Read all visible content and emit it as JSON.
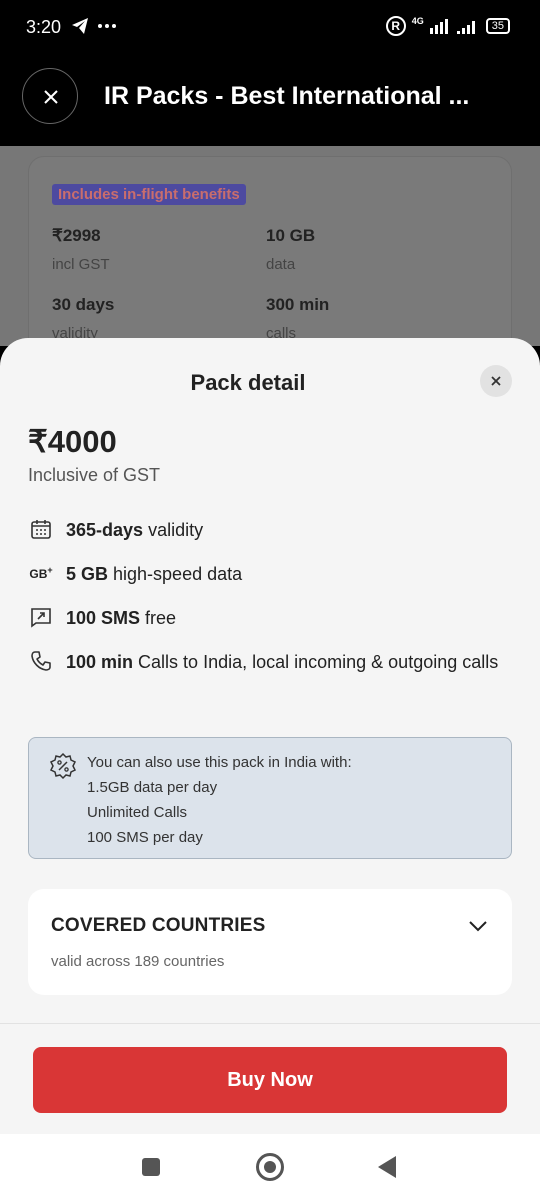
{
  "status_bar": {
    "time": "3:20",
    "network": "4G",
    "battery": "35",
    "icons": [
      "telegram-icon",
      "more-dots-icon",
      "r-icon",
      "signal-icon",
      "battery-icon"
    ]
  },
  "header": {
    "title": "IR Packs - Best International ..."
  },
  "background_card": {
    "badge": "Includes in-flight benefits",
    "price": "₹2998",
    "price_sub": "incl GST",
    "data": "10 GB",
    "data_sub": "data",
    "validity": "30 days",
    "validity_sub": "validity",
    "calls": "300 min",
    "calls_sub": "calls"
  },
  "sheet": {
    "title": "Pack detail",
    "price": "₹4000",
    "price_sub": "Inclusive of GST",
    "features": [
      {
        "icon": "calendar-icon",
        "bold": "365-days",
        "text": " validity"
      },
      {
        "icon": "gb-plus-icon",
        "icon_label": "GB",
        "bold": "5 GB",
        "text": " high-speed data"
      },
      {
        "icon": "sms-icon",
        "bold": "100 SMS",
        "text": " free"
      },
      {
        "icon": "phone-icon",
        "bold": "100 min",
        "text": " Calls to India, local incoming & outgoing calls"
      }
    ],
    "info": {
      "lines": [
        "You can also use this pack in India with:",
        "1.5GB data per day",
        "Unlimited Calls",
        "100 SMS per day"
      ]
    },
    "countries": {
      "title": "COVERED COUNTRIES",
      "sub": "valid across 189 countries"
    },
    "buy_label": "Buy Now"
  },
  "colors": {
    "accent": "#d93636",
    "info_bg": "#dce3eb",
    "header_bg": "#000000"
  }
}
